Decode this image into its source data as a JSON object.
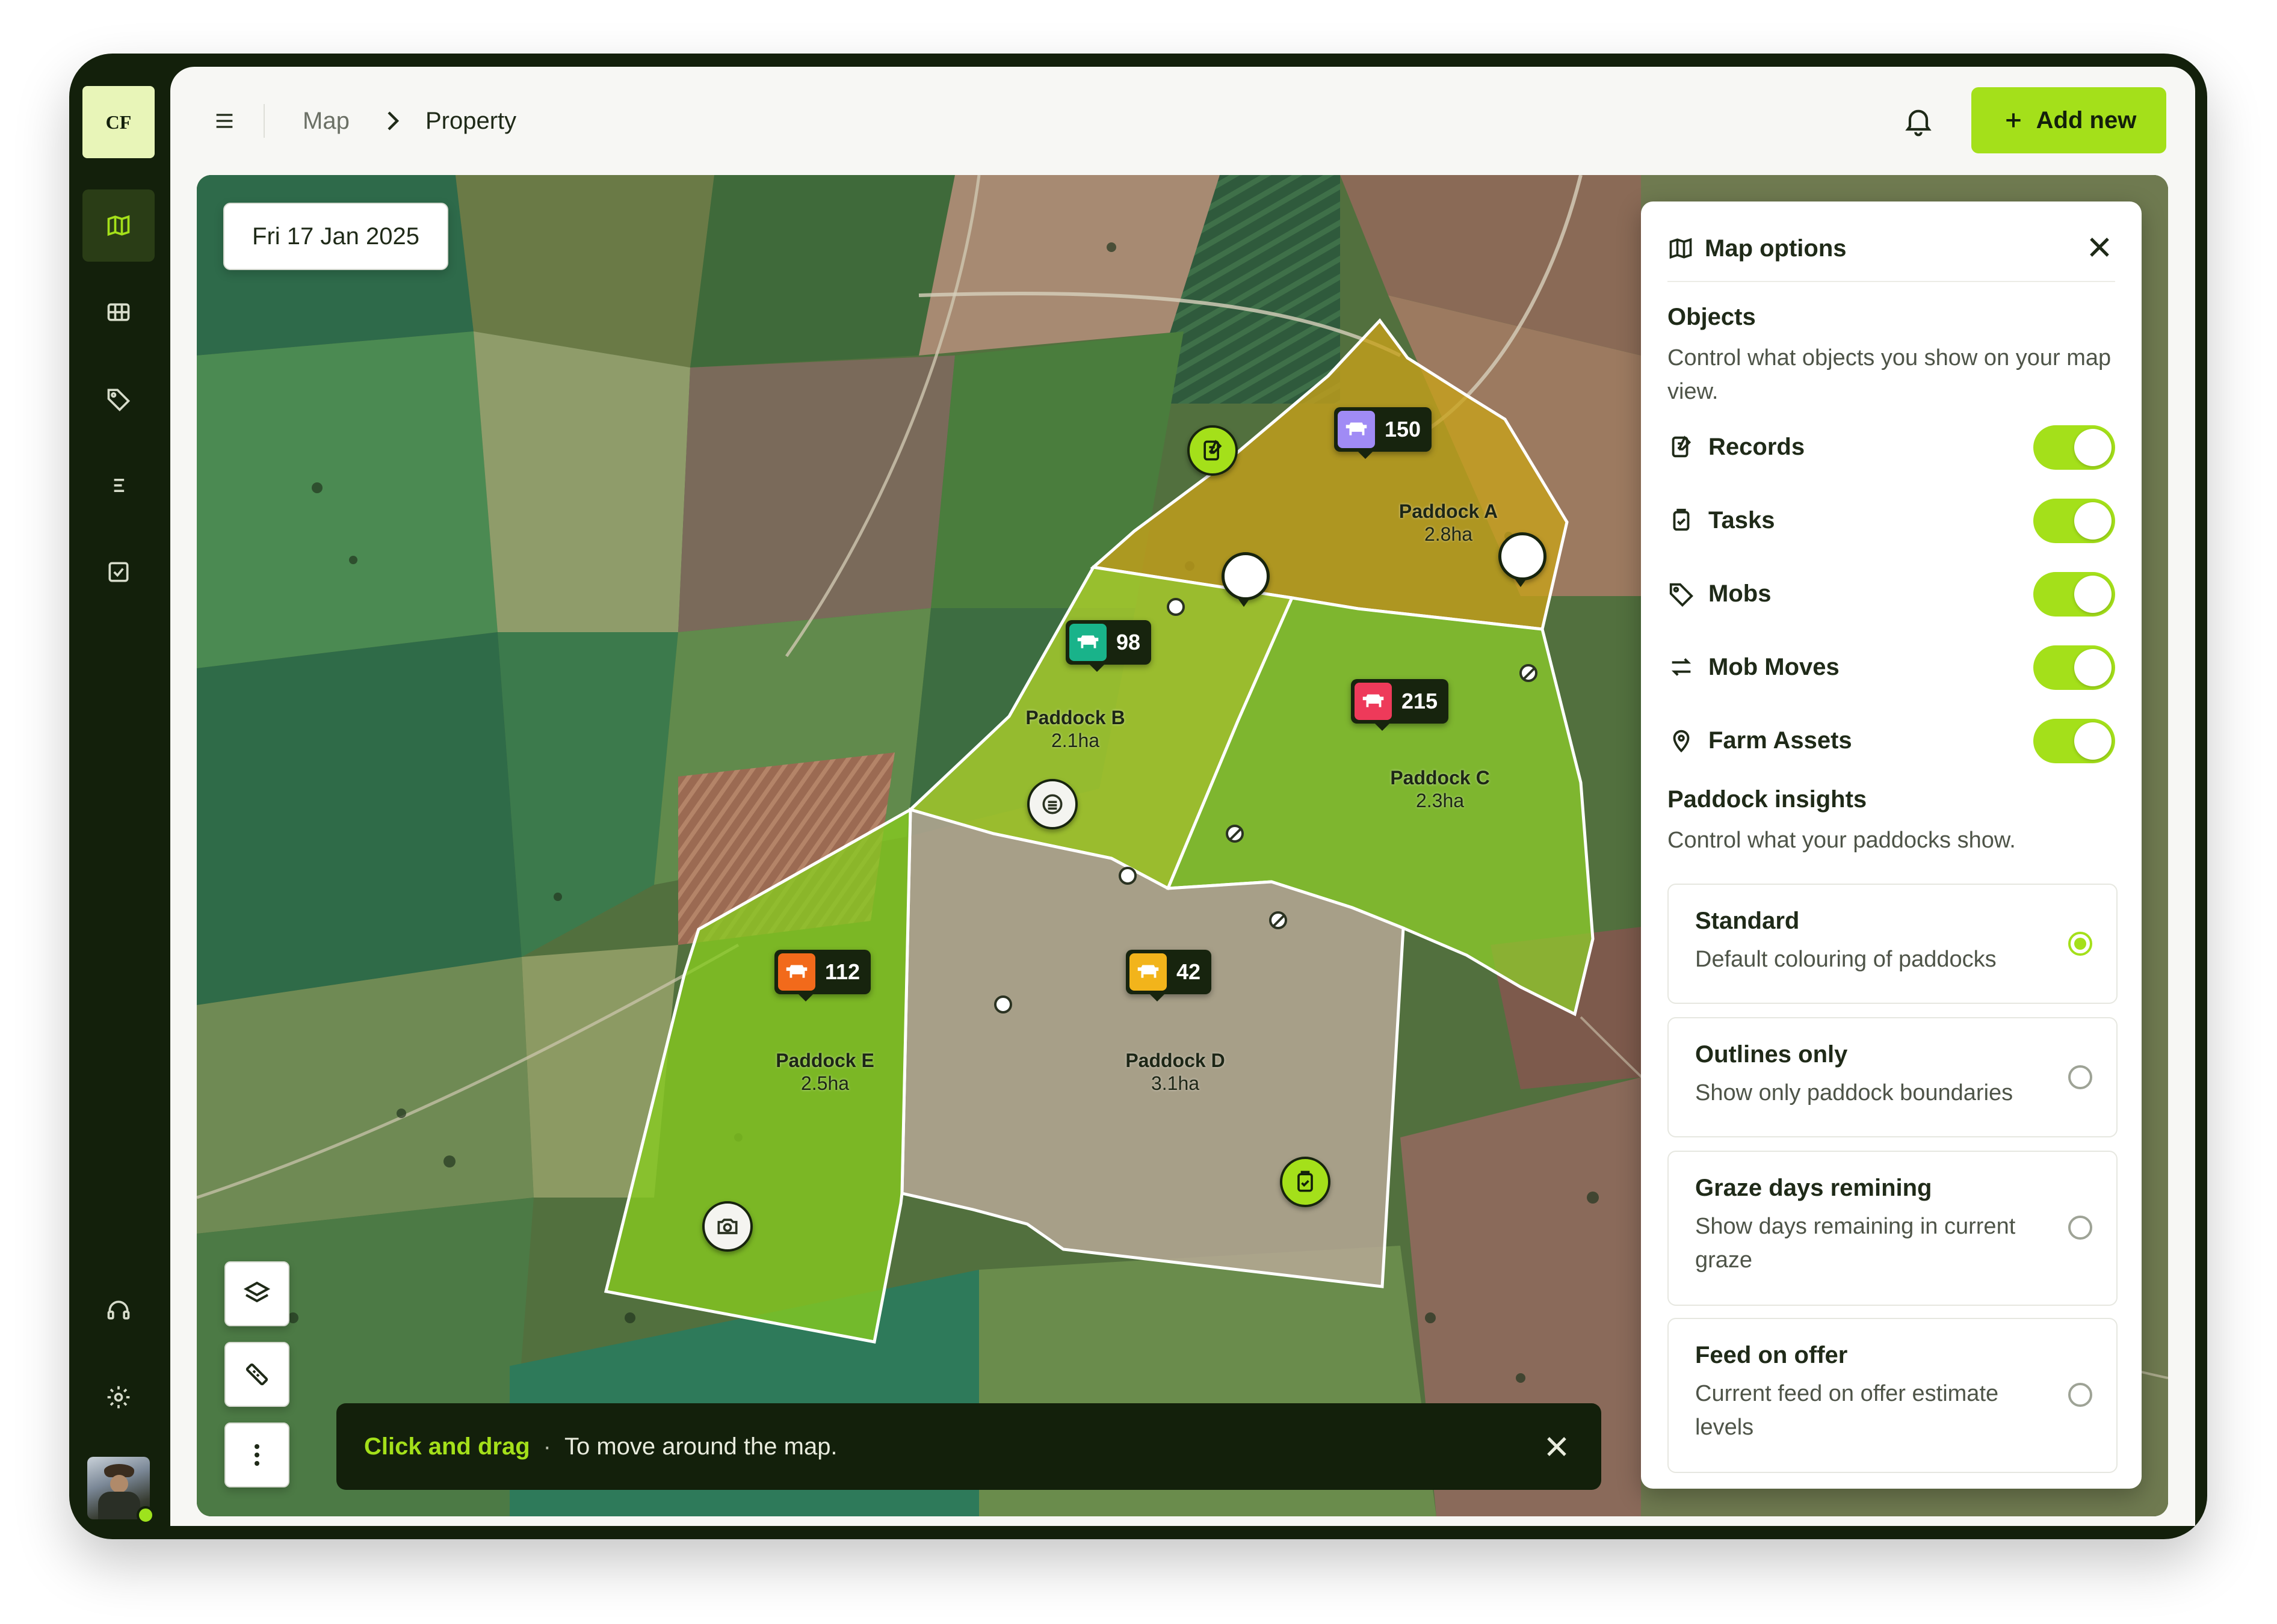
{
  "app": {
    "logo_text": "CF"
  },
  "rail": {
    "items": [
      {
        "name": "map-icon",
        "active": true
      },
      {
        "name": "paddocks-icon",
        "active": false
      },
      {
        "name": "tag-icon",
        "active": false
      },
      {
        "name": "list-icon",
        "active": false
      },
      {
        "name": "tasks-icon",
        "active": false
      }
    ],
    "bottom": [
      "headset-icon",
      "gear-icon"
    ]
  },
  "topbar": {
    "breadcrumb": [
      "Map",
      "Property"
    ],
    "add_label": "Add new"
  },
  "map": {
    "date": "Fri 17 Jan 2025",
    "paddocks": [
      {
        "name": "Paddock A",
        "area": "2.8ha",
        "fill": "#c8a21a"
      },
      {
        "name": "Paddock B",
        "area": "2.1ha",
        "fill": "#b3d52a"
      },
      {
        "name": "Paddock C",
        "area": "2.3ha",
        "fill": "#8fd12a"
      },
      {
        "name": "Paddock D",
        "area": "3.1ha",
        "fill": "#b9a998"
      },
      {
        "name": "Paddock E",
        "area": "2.5ha",
        "fill": "#86cc1f"
      }
    ],
    "herds": [
      {
        "count": "150",
        "color": "#a08bf5"
      },
      {
        "count": "98",
        "color": "#19b38a"
      },
      {
        "count": "215",
        "color": "#ee3a5a"
      },
      {
        "count": "112",
        "color": "#f26a1b"
      },
      {
        "count": "42",
        "color": "#f2b41b"
      }
    ],
    "hint": {
      "highlight": "Click and drag",
      "separator": "·",
      "text": "To move around the map."
    }
  },
  "panel": {
    "title": "Map options",
    "objects_title": "Objects",
    "objects_desc": "Control what objects you show on your map view.",
    "toggles": [
      {
        "label": "Records",
        "icon": "records-icon",
        "on": true
      },
      {
        "label": "Tasks",
        "icon": "clipboard-icon",
        "on": true
      },
      {
        "label": "Mobs",
        "icon": "tag-icon",
        "on": true
      },
      {
        "label": "Mob Moves",
        "icon": "arrows-icon",
        "on": true
      },
      {
        "label": "Farm Assets",
        "icon": "location-pin-icon",
        "on": true
      }
    ],
    "insights_title": "Paddock insights",
    "insights_desc": "Control what your paddocks show.",
    "options": [
      {
        "title": "Standard",
        "desc": "Default colouring of paddocks",
        "selected": true
      },
      {
        "title": "Outlines only",
        "desc": "Show only paddock boundaries",
        "selected": false
      },
      {
        "title": "Graze days remining",
        "desc": "Show days remaining in current graze",
        "selected": false
      },
      {
        "title": "Feed on offer",
        "desc": "Current feed on offer estimate levels",
        "selected": false
      }
    ]
  }
}
